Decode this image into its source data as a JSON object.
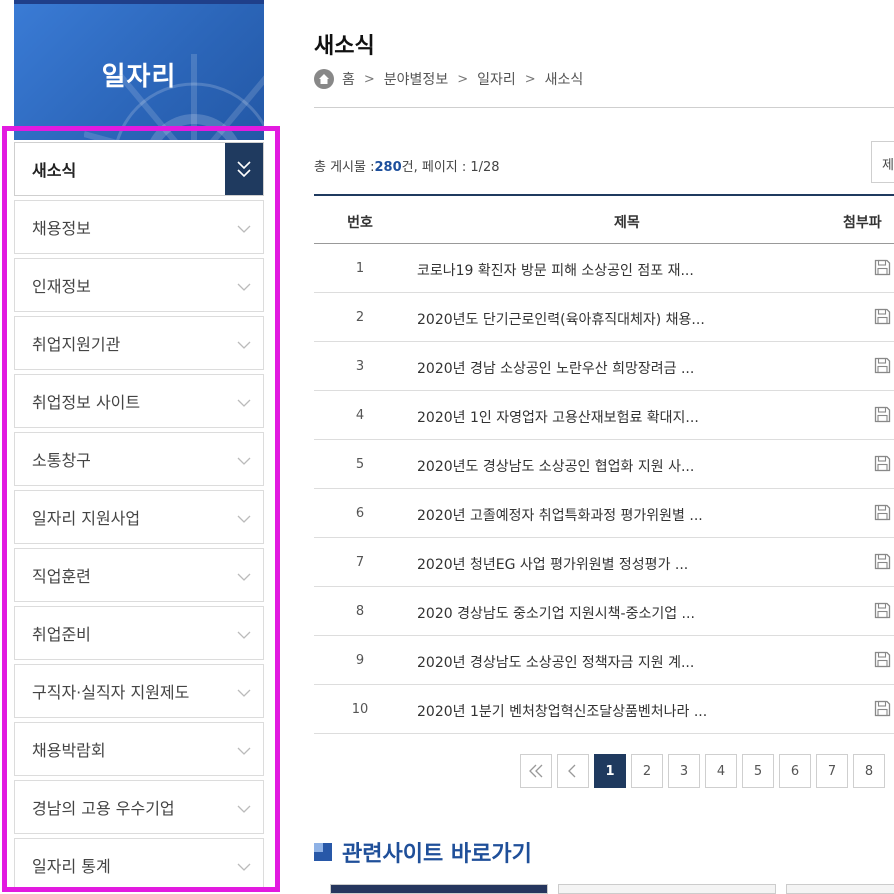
{
  "sidebar": {
    "banner_title": "일자리",
    "items": [
      {
        "label": "새소식",
        "active": true
      },
      {
        "label": "채용정보"
      },
      {
        "label": "인재정보"
      },
      {
        "label": "취업지원기관"
      },
      {
        "label": "취업정보 사이트"
      },
      {
        "label": "소통창구"
      },
      {
        "label": "일자리 지원사업"
      },
      {
        "label": "직업훈련"
      },
      {
        "label": "취업준비"
      },
      {
        "label": "구직자·실직자 지원제도"
      },
      {
        "label": "채용박람회"
      },
      {
        "label": "경남의 고용 우수기업"
      },
      {
        "label": "일자리 통계"
      }
    ]
  },
  "header": {
    "title": "새소식",
    "breadcrumb": [
      "홈",
      "분야별정보",
      "일자리",
      "새소식"
    ]
  },
  "board": {
    "total_prefix": "총 게시물 :",
    "total_count": "280",
    "total_suffix": "건, 페이지 : 1/28",
    "search_select": "제",
    "columns": {
      "no": "번호",
      "subject": "제목",
      "file": "첨부파"
    },
    "rows": [
      {
        "no": "1",
        "subject": "코로나19 확진자 방문 피해 소상공인 점포 재..."
      },
      {
        "no": "2",
        "subject": "2020년도 단기근로인력(육아휴직대체자) 채용..."
      },
      {
        "no": "3",
        "subject": "2020년 경남 소상공인 노란우산 희망장려금 ..."
      },
      {
        "no": "4",
        "subject": "2020년 1인 자영업자 고용산재보험료 확대지..."
      },
      {
        "no": "5",
        "subject": "2020년도 경상남도 소상공인 협업화 지원 사..."
      },
      {
        "no": "6",
        "subject": "2020년 고졸예정자 취업특화과정 평가위원별 ..."
      },
      {
        "no": "7",
        "subject": "2020년 청년EG 사업 평가위원별 정성평가 ..."
      },
      {
        "no": "8",
        "subject": "2020 경상남도 중소기업 지원시책-중소기업 ..."
      },
      {
        "no": "9",
        "subject": "2020년 경상남도 소상공인 정책자금 지원 계..."
      },
      {
        "no": "10",
        "subject": "2020년 1분기 벤처창업혁신조달상품벤처나라 ..."
      }
    ]
  },
  "pagination": {
    "first": "«",
    "prev": "‹",
    "pages": [
      "1",
      "2",
      "3",
      "4",
      "5",
      "6",
      "7",
      "8"
    ],
    "current": "1"
  },
  "related": {
    "title": "관련사이트 바로가기"
  },
  "colors": {
    "navy": "#1f3a5f",
    "accent_magenta": "#e21ae0",
    "banner_blue": "#2b65b8",
    "link_blue": "#1d4f9c"
  },
  "icons": [
    "home-icon",
    "chevron-down-icon",
    "double-chevron-down-icon",
    "floppy-disk-icon",
    "double-chevron-left-icon",
    "chevron-left-icon"
  ]
}
